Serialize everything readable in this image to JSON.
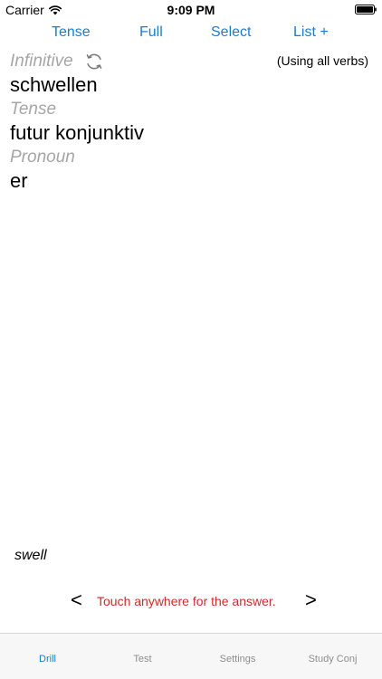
{
  "status_bar": {
    "carrier": "Carrier",
    "time": "9:09 PM"
  },
  "toolbar": {
    "tense_label": "Tense",
    "full_label": "Full",
    "select_label": "Select",
    "list_label": "List +"
  },
  "drill": {
    "infinitive_label": "Infinitive",
    "infinitive_value": "schwellen",
    "tense_label": "Tense",
    "tense_value": "futur konjunktiv",
    "pronoun_label": "Pronoun",
    "pronoun_value": "er",
    "verb_scope": "(Using all verbs)",
    "translation": "swell",
    "prev_arrow": "<",
    "next_arrow": ">",
    "hint": "Touch anywhere for the answer."
  },
  "tab_bar": {
    "items": [
      {
        "label": "Drill",
        "active": true
      },
      {
        "label": "Test",
        "active": false
      },
      {
        "label": "Settings",
        "active": false
      },
      {
        "label": "Study Conj",
        "active": false
      }
    ]
  },
  "colors": {
    "accent": "#1a7cd9",
    "hint": "#d42a2a",
    "label_gray": "#a6a6a6",
    "tab_inactive": "#8e8e8e"
  },
  "icons": [
    "wifi-icon",
    "battery-icon",
    "refresh-icon"
  ]
}
